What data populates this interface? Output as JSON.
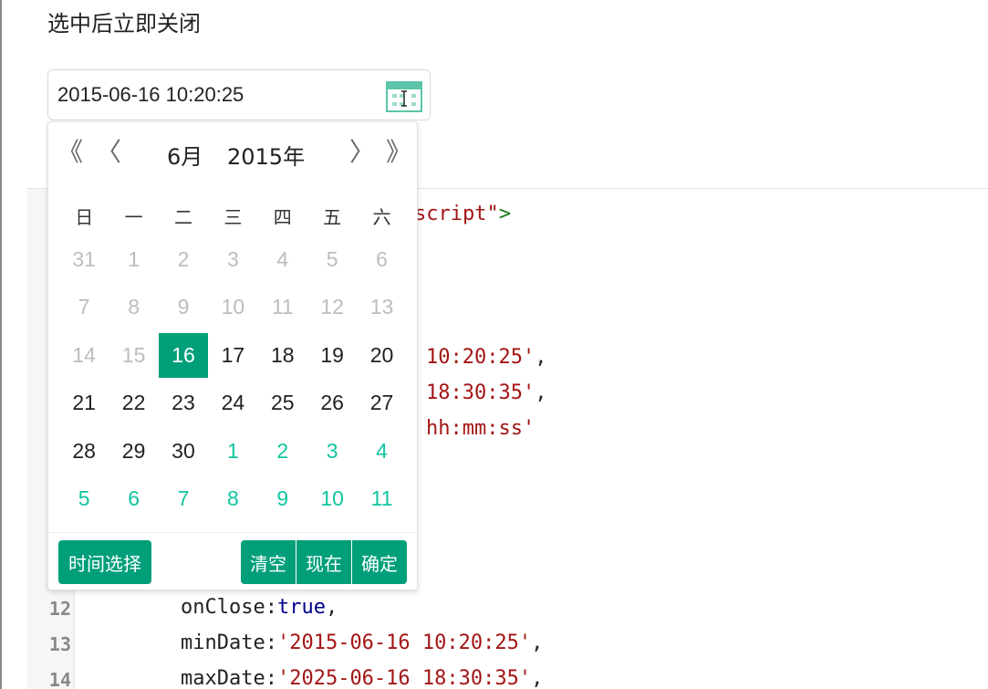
{
  "section": {
    "title": "选中后立即关闭"
  },
  "input": {
    "value": "2015-06-16 10:20:25"
  },
  "picker": {
    "nav": {
      "prev_year": "《",
      "prev_month": "〈",
      "next_month": "〉",
      "next_year": "》"
    },
    "month_label": "6月",
    "year_label": "2015年",
    "weekdays": [
      "日",
      "一",
      "二",
      "三",
      "四",
      "五",
      "六"
    ],
    "days": [
      {
        "d": "31",
        "t": "prev"
      },
      {
        "d": "1",
        "t": "prev"
      },
      {
        "d": "2",
        "t": "prev"
      },
      {
        "d": "3",
        "t": "prev"
      },
      {
        "d": "4",
        "t": "prev"
      },
      {
        "d": "5",
        "t": "prev"
      },
      {
        "d": "6",
        "t": "prev"
      },
      {
        "d": "7",
        "t": "prev"
      },
      {
        "d": "8",
        "t": "prev"
      },
      {
        "d": "9",
        "t": "prev"
      },
      {
        "d": "10",
        "t": "prev"
      },
      {
        "d": "11",
        "t": "prev"
      },
      {
        "d": "12",
        "t": "prev"
      },
      {
        "d": "13",
        "t": "prev"
      },
      {
        "d": "14",
        "t": "prev"
      },
      {
        "d": "15",
        "t": "prev"
      },
      {
        "d": "16",
        "t": "sel"
      },
      {
        "d": "17",
        "t": "cur"
      },
      {
        "d": "18",
        "t": "cur"
      },
      {
        "d": "19",
        "t": "cur"
      },
      {
        "d": "20",
        "t": "cur"
      },
      {
        "d": "21",
        "t": "cur"
      },
      {
        "d": "22",
        "t": "cur"
      },
      {
        "d": "23",
        "t": "cur"
      },
      {
        "d": "24",
        "t": "cur"
      },
      {
        "d": "25",
        "t": "cur"
      },
      {
        "d": "26",
        "t": "cur"
      },
      {
        "d": "27",
        "t": "cur"
      },
      {
        "d": "28",
        "t": "cur"
      },
      {
        "d": "29",
        "t": "cur"
      },
      {
        "d": "30",
        "t": "cur"
      },
      {
        "d": "1",
        "t": "next"
      },
      {
        "d": "2",
        "t": "next"
      },
      {
        "d": "3",
        "t": "next"
      },
      {
        "d": "4",
        "t": "next"
      },
      {
        "d": "5",
        "t": "next"
      },
      {
        "d": "6",
        "t": "next"
      },
      {
        "d": "7",
        "t": "next"
      },
      {
        "d": "8",
        "t": "next"
      },
      {
        "d": "9",
        "t": "next"
      },
      {
        "d": "10",
        "t": "next"
      },
      {
        "d": "11",
        "t": "next"
      }
    ],
    "buttons": {
      "time": "时间选择",
      "clear": "清空",
      "now": "现在",
      "ok": "确定"
    }
  },
  "code": {
    "frag_script": "script\"",
    "frag_gt": ">",
    "frag_time1": "10:20:25'",
    "frag_time2": "18:30:35'",
    "frag_fmt": "hh:mm:ss'",
    "comma": ",",
    "ln12": "12",
    "ln13": "13",
    "ln14": "14",
    "l12_key": "onClose:",
    "l12_val": "true",
    "l13_key": "minDate:",
    "l13_val": "'2015-06-16 10:20:25'",
    "l14_key": "maxDate:",
    "l14_val": "'2025-06-16 18:30:35'"
  },
  "colors": {
    "accent": "#009f7a",
    "next_month": "#11c5a0",
    "string": "#a31515",
    "keyword": "#00008b"
  },
  "icons": {
    "input_trailing": "calendar-icon",
    "cursor": "text-cursor-icon"
  }
}
